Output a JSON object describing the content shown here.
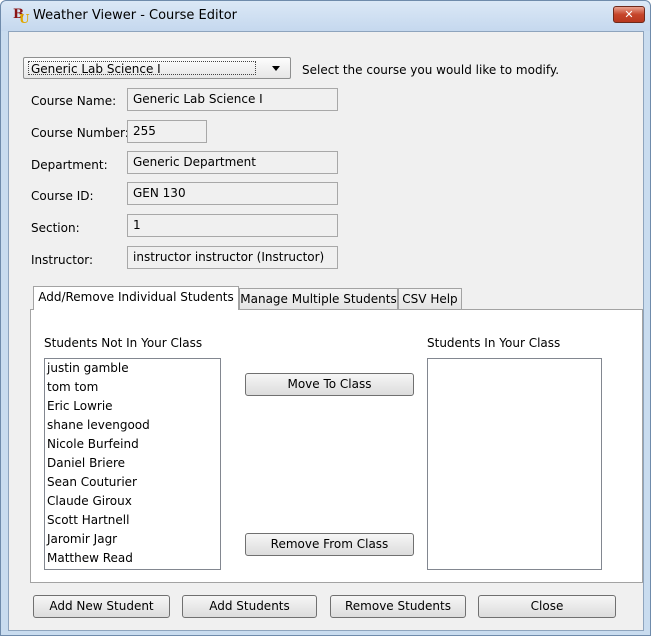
{
  "window": {
    "title": "Weather Viewer - Course Editor",
    "close_symbol": "✕",
    "app_icon_letters": [
      "B",
      "U"
    ]
  },
  "course_selector": {
    "selected": "Generic Lab Science I",
    "hint": "Select the course you would like to modify."
  },
  "fields": {
    "course_name": {
      "label": "Course Name:",
      "value": "Generic Lab Science I"
    },
    "course_number": {
      "label": "Course Number:",
      "value": "255"
    },
    "department": {
      "label": "Department:",
      "value": "Generic Department"
    },
    "course_id": {
      "label": "Course ID:",
      "value": "GEN 130"
    },
    "section": {
      "label": "Section:",
      "value": "1"
    },
    "instructor": {
      "label": "Instructor:",
      "value": "instructor instructor (Instructor)"
    }
  },
  "tabs": [
    {
      "label": "Add/Remove Individual Students",
      "active": true
    },
    {
      "label": "Manage Multiple Students",
      "active": false
    },
    {
      "label": "CSV Help",
      "active": false
    }
  ],
  "students_not_in_class": {
    "title": "Students Not In Your Class",
    "items": [
      "justin gamble",
      "tom tom",
      "Eric Lowrie",
      "shane levengood",
      "Nicole Burfeind",
      "Daniel Briere",
      "Sean Couturier",
      "Claude Giroux",
      "Scott Hartnell",
      "Jaromir Jagr",
      "Matthew Read"
    ]
  },
  "students_in_class": {
    "title": "Students In Your Class",
    "items": []
  },
  "transfer_buttons": {
    "move_to_class": "Move To Class",
    "remove_from_class": "Remove From Class"
  },
  "footer_buttons": {
    "add_new_student": "Add New Student",
    "add_students": "Add Students",
    "remove_students": "Remove Students",
    "close": "Close"
  },
  "colors": {
    "title_bar": "#c5d8ee",
    "close_button": "#c6452a",
    "logo_primary": "#8a1515",
    "logo_accent": "#e0a700"
  },
  "icons": {
    "app_icon": "bu-logo-icon",
    "close_icon": "close-icon",
    "combo_icon": "chevron-down-icon"
  }
}
